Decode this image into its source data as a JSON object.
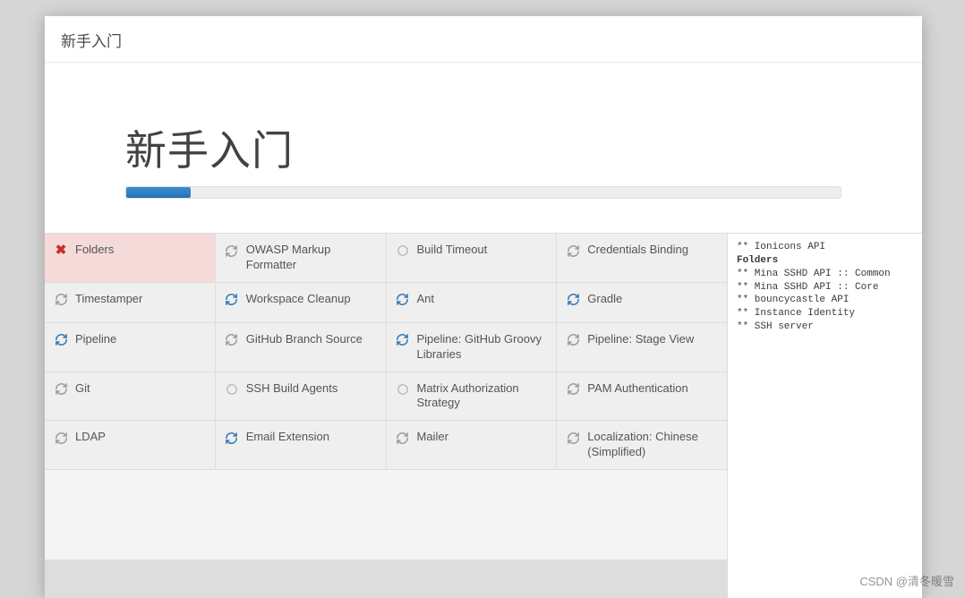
{
  "modal": {
    "header_title": "新手入门",
    "hero_title": "新手入门"
  },
  "progress": {
    "percent": 9
  },
  "plugins": [
    {
      "name": "Folders",
      "status": "failed"
    },
    {
      "name": "OWASP Markup Formatter",
      "status": "spinning"
    },
    {
      "name": "Build Timeout",
      "status": "pending"
    },
    {
      "name": "Credentials Binding",
      "status": "spinning"
    },
    {
      "name": "Timestamper",
      "status": "spinning"
    },
    {
      "name": "Workspace Cleanup",
      "status": "active"
    },
    {
      "name": "Ant",
      "status": "active"
    },
    {
      "name": "Gradle",
      "status": "active"
    },
    {
      "name": "Pipeline",
      "status": "active"
    },
    {
      "name": "GitHub Branch Source",
      "status": "spinning"
    },
    {
      "name": "Pipeline: GitHub Groovy Libraries",
      "status": "active"
    },
    {
      "name": "Pipeline: Stage View",
      "status": "spinning"
    },
    {
      "name": "Git",
      "status": "spinning"
    },
    {
      "name": "SSH Build Agents",
      "status": "pending"
    },
    {
      "name": "Matrix Authorization Strategy",
      "status": "pending"
    },
    {
      "name": "PAM Authentication",
      "status": "spinning"
    },
    {
      "name": "LDAP",
      "status": "spinning"
    },
    {
      "name": "Email Extension",
      "status": "active"
    },
    {
      "name": "Mailer",
      "status": "spinning"
    },
    {
      "name": "Localization: Chinese (Simplified)",
      "status": "spinning"
    }
  ],
  "log": [
    {
      "text": "** Ionicons API",
      "bold": false
    },
    {
      "text": "Folders",
      "bold": true
    },
    {
      "text": "** Mina SSHD API :: Common",
      "bold": false
    },
    {
      "text": "** Mina SSHD API :: Core",
      "bold": false
    },
    {
      "text": "** bouncycastle API",
      "bold": false
    },
    {
      "text": "** Instance Identity",
      "bold": false
    },
    {
      "text": "** SSH server",
      "bold": false
    }
  ],
  "watermark": "CSDN @清冬暖雪"
}
